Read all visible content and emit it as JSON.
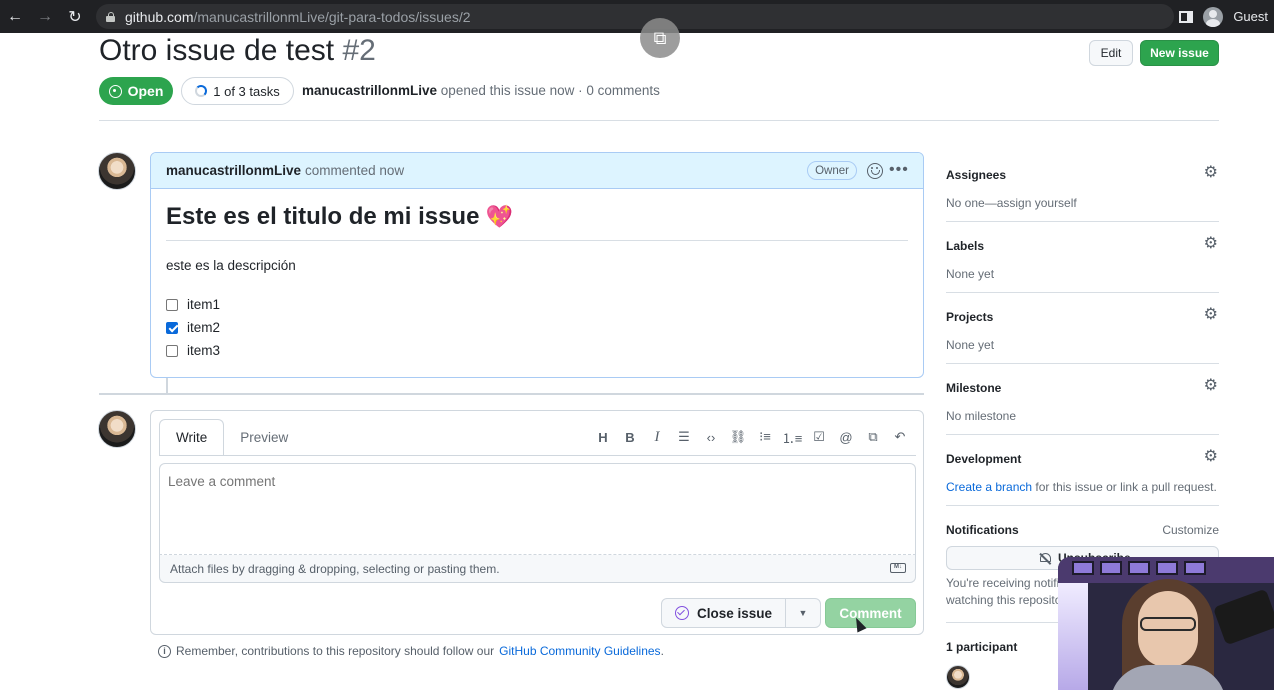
{
  "browser": {
    "url_domain": "github.com",
    "url_path": "/manucastrillonmLive/git-para-todos/issues/2",
    "profile_label": "Guest"
  },
  "issue": {
    "title": "Otro issue de test",
    "number": "#2",
    "state": "Open",
    "tasks": "1 of 3 tasks",
    "author": "manucastrillonmLive",
    "meta": " opened this issue now · 0 comments",
    "edit_label": "Edit",
    "new_issue_label": "New issue"
  },
  "comment": {
    "author": "manucastrillonmLive",
    "time": "commented now",
    "role": "Owner",
    "heading": "Este es el titulo de mi issue",
    "emoji": "💖",
    "paragraph": "este es la descripción",
    "tasks": [
      {
        "label": "item1",
        "checked": false
      },
      {
        "label": "item2",
        "checked": true
      },
      {
        "label": "item3",
        "checked": false
      }
    ]
  },
  "editor": {
    "tab_write": "Write",
    "tab_preview": "Preview",
    "placeholder": "Leave a comment",
    "attach_text": "Attach files by dragging & dropping, selecting or pasting them.",
    "close_label": "Close issue",
    "comment_label": "Comment",
    "toolbar_icons": [
      "heading-icon",
      "bold-icon",
      "italic-icon",
      "quote-icon",
      "code-icon",
      "link-icon",
      "bulleted-list-icon",
      "numbered-list-icon",
      "task-list-icon",
      "mention-icon",
      "reference-icon",
      "reply-icon"
    ]
  },
  "guidelines": {
    "text": "Remember, contributions to this repository should follow our",
    "link": "GitHub Community Guidelines",
    "end": "."
  },
  "sidebar": {
    "assignees": {
      "label": "Assignees",
      "value": "No one—assign yourself"
    },
    "labels": {
      "label": "Labels",
      "value": "None yet"
    },
    "projects": {
      "label": "Projects",
      "value": "None yet"
    },
    "milestone": {
      "label": "Milestone",
      "value": "No milestone"
    },
    "development": {
      "label": "Development",
      "link": "Create a branch",
      "value": " for this issue or link a pull request."
    },
    "notifications": {
      "label": "Notifications",
      "customize": "Customize",
      "button": "Unsubscribe",
      "line1": "You're receiving notifications because you're",
      "line2": "watching this repository."
    },
    "participants": {
      "label": "1 participant"
    }
  }
}
